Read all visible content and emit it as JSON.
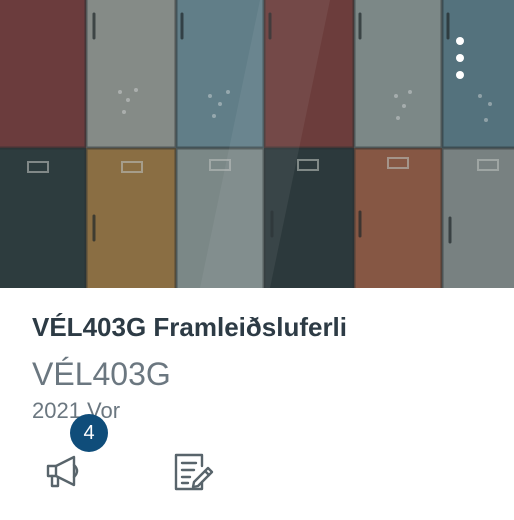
{
  "course": {
    "title": "VÉL403G Framleiðsluferli",
    "code": "VÉL403G",
    "term": "2021 Vor"
  },
  "actions": {
    "announcements_count": "4",
    "announcements_icon": "megaphone-icon",
    "assignments_icon": "assignment-edit-icon"
  },
  "colors": {
    "title": "#2d3b45",
    "secondary_text": "#6b7780",
    "badge": "#0f4d7a"
  }
}
